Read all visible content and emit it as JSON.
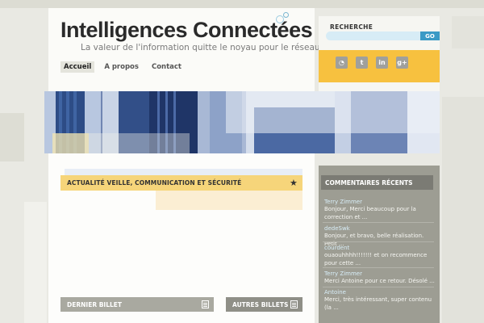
{
  "header": {
    "site_title": "Intelligences Connectées",
    "tagline": "La valeur de l'information quitte le noyau pour le réseau"
  },
  "nav": [
    {
      "label": "Accueil",
      "active": true
    },
    {
      "label": "A propos",
      "active": false
    },
    {
      "label": "Contact",
      "active": false
    }
  ],
  "search": {
    "label": "RECHERCHE",
    "placeholder": "",
    "go_label": "GO"
  },
  "social": {
    "icons": [
      "rss-icon",
      "twitter-icon",
      "linkedin-icon",
      "googleplus-icon"
    ],
    "glyphs": [
      "◔",
      "t",
      "in",
      "g+"
    ]
  },
  "main": {
    "section_title": "ACTUALITÉ VEILLE, COMMUNICATION ET SÉCURITÉ",
    "latest_label": "DERNIER BILLET",
    "other_label": "AUTRES BILLETS"
  },
  "sidebar": {
    "comments_title": "COMMENTAIRES RÉCENTS",
    "comments": [
      {
        "author": "Terry Zimmer",
        "text": "Bonjour, Merci beaucoup pour la correction et ..."
      },
      {
        "author": "dedeSwk",
        "text": "Bonjour, et bravo, belle réalisation. Petit ..."
      },
      {
        "author": "courdent",
        "text": "ouaouhhhh!!!!!!! et on recommence pour cette ..."
      },
      {
        "author": "Terry Zimmer",
        "text": "Merci Antoine pour ce retour. Désolé ..."
      },
      {
        "author": "Antoine",
        "text": "Merci, très intéressant, super contenu (la ..."
      }
    ]
  },
  "colors": {
    "accent_yellow": "#f6d57a",
    "social_orange": "#f7c13f",
    "search_blue": "#3b9ac6",
    "sidebar_gray": "#9d9d93"
  }
}
